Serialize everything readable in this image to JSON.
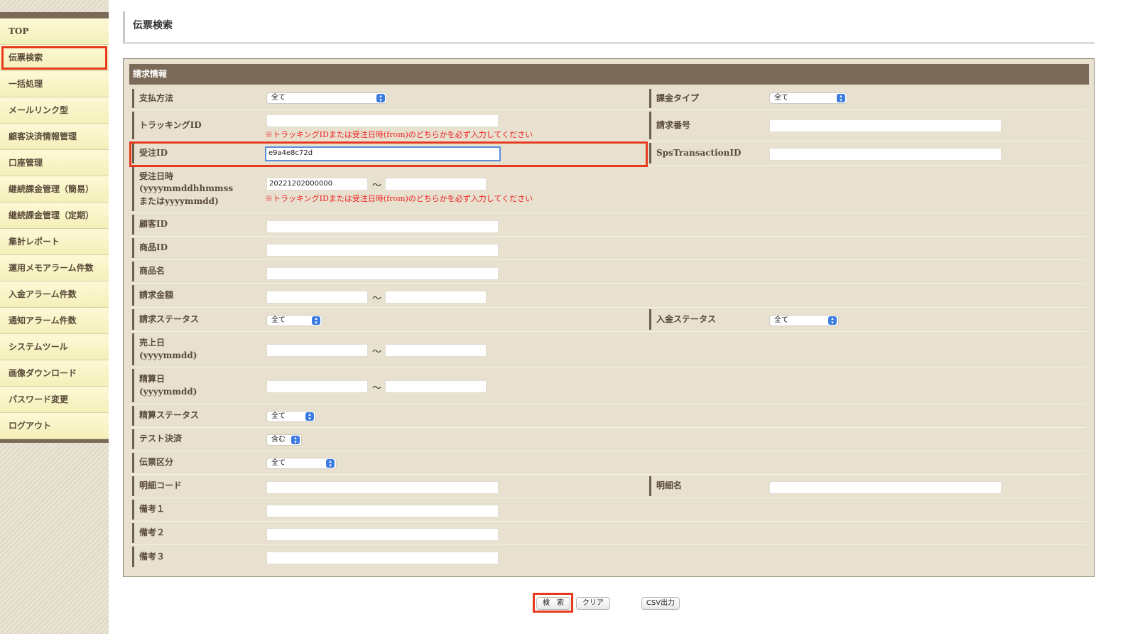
{
  "sidebar": {
    "items": [
      {
        "label": "TOP"
      },
      {
        "label": "伝票検索"
      },
      {
        "label": "一括処理"
      },
      {
        "label": "メールリンク型"
      },
      {
        "label": "顧客決済情報管理"
      },
      {
        "label": "口座管理"
      },
      {
        "label": "継続課金管理（簡易）"
      },
      {
        "label": "継続課金管理（定期）"
      },
      {
        "label": "集計レポート"
      },
      {
        "label": "運用メモアラーム件数"
      },
      {
        "label": "入金アラーム件数"
      },
      {
        "label": "通知アラーム件数"
      },
      {
        "label": "システムツール"
      },
      {
        "label": "画像ダウンロード"
      },
      {
        "label": "パスワード変更"
      },
      {
        "label": "ログアウト"
      }
    ],
    "active_index": 1
  },
  "page": {
    "title": "伝票検索"
  },
  "panel": {
    "header": "請求情報"
  },
  "form": {
    "payment_method": {
      "label": "支払方法",
      "value": "全て"
    },
    "billing_type": {
      "label": "課金タイプ",
      "value": "全て"
    },
    "tracking_id": {
      "label": "トラッキングID",
      "value": "",
      "note": "※トラッキングIDまたは受注日時(from)のどちらかを必ず入力してください"
    },
    "invoice_number": {
      "label": "請求番号",
      "value": ""
    },
    "order_id": {
      "label": "受注ID",
      "value": "e9a4e8c72d"
    },
    "sps_transaction_id": {
      "label": "SpsTransactionID",
      "value": ""
    },
    "order_datetime": {
      "label_line1": "受注日時",
      "label_line2": "(yyyymmddhhmmss",
      "label_line3": "またはyyyymmdd)",
      "from": "20221202000000",
      "to": "",
      "note": "※トラッキングIDまたは受注日時(from)のどちらかを必ず入力してください"
    },
    "customer_id": {
      "label": "顧客ID",
      "value": ""
    },
    "product_id": {
      "label": "商品ID",
      "value": ""
    },
    "product_name": {
      "label": "商品名",
      "value": ""
    },
    "billing_amount": {
      "label": "請求金額",
      "from": "",
      "to": ""
    },
    "billing_status": {
      "label": "請求ステータス",
      "value": "全て"
    },
    "payment_status": {
      "label": "入金ステータス",
      "value": "全て"
    },
    "sales_date": {
      "label_line1": "売上日",
      "label_line2": "(yyyymmdd)",
      "from": "",
      "to": ""
    },
    "settlement_date": {
      "label_line1": "精算日",
      "label_line2": "(yyyymmdd)",
      "from": "",
      "to": ""
    },
    "settlement_status": {
      "label": "精算ステータス",
      "value": "全て"
    },
    "test_payment": {
      "label": "テスト決済",
      "value": "含む"
    },
    "slip_category": {
      "label": "伝票区分",
      "value": "全て"
    },
    "detail_code": {
      "label": "明細コード",
      "value": ""
    },
    "detail_name": {
      "label": "明細名",
      "value": ""
    },
    "remarks1": {
      "label": "備考１",
      "value": ""
    },
    "remarks2": {
      "label": "備考２",
      "value": ""
    },
    "remarks3": {
      "label": "備考３",
      "value": ""
    },
    "tilde": "～"
  },
  "buttons": {
    "search": "検　索",
    "clear": "クリア",
    "csv": "CSV出力"
  },
  "colors": {
    "header_brown": "#7a6a57",
    "panel_bg": "#e8e1d0",
    "highlight_red": "#e63a1e",
    "note_red": "#e22222"
  }
}
